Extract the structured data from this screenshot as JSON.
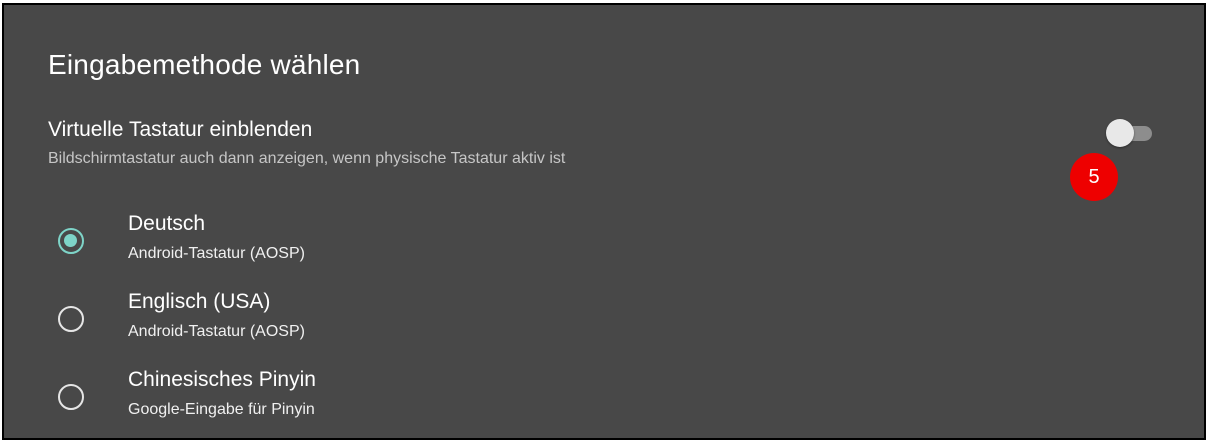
{
  "dialog": {
    "title": "Eingabemethode wählen"
  },
  "virtual_keyboard": {
    "title": "Virtuelle Tastatur einblenden",
    "summary": "Bildschirmtastatur auch dann anzeigen, wenn physische Tastatur aktiv ist",
    "enabled": false
  },
  "badge": {
    "number": "5",
    "color": "#ee0000"
  },
  "methods": [
    {
      "title": "Deutsch",
      "subtitle": "Android-Tastatur (AOSP)",
      "selected": true
    },
    {
      "title": "Englisch (USA)",
      "subtitle": "Android-Tastatur (AOSP)",
      "selected": false
    },
    {
      "title": "Chinesisches Pinyin",
      "subtitle": "Google-Eingabe für Pinyin",
      "selected": false
    }
  ],
  "colors": {
    "background": "#484848",
    "accent": "#7ed4c8",
    "text": "#ffffff"
  }
}
